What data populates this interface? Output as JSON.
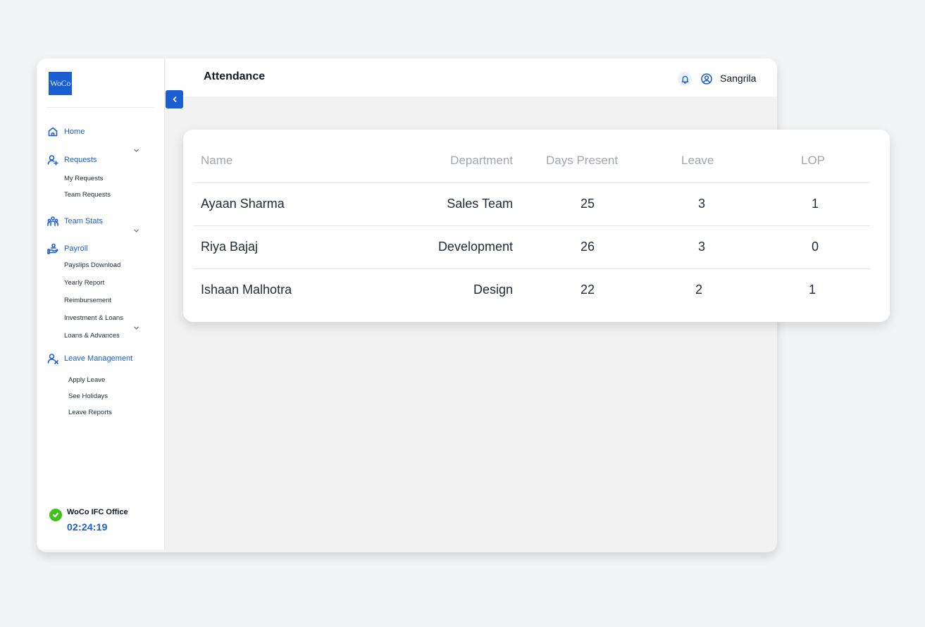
{
  "app": {
    "logo_text": "WoCo",
    "page_title": "Attendance",
    "user_name": "Sangrila"
  },
  "sidebar": {
    "home": "Home",
    "requests": {
      "label": "Requests",
      "items": [
        "My Requests",
        "Team Requests"
      ]
    },
    "team_stats": {
      "label": "Team Stats"
    },
    "payroll": {
      "label": "Payroll",
      "items": [
        "Payslips Download",
        "Yearly Report",
        "Reimbursement",
        "Investment & Loans",
        "Loans & Advances"
      ]
    },
    "leave_management": {
      "label": "Leave Management",
      "items": [
        "Apply Leave",
        "See Holidays",
        "Leave Reports"
      ]
    },
    "office": {
      "name": "WoCo IFC Office",
      "timer": "02:24:19",
      "status_color": "#43c11b"
    }
  },
  "table": {
    "headers": [
      "Name",
      "Department",
      "Days Present",
      "Leave",
      "LOP"
    ],
    "rows": [
      [
        "Ayaan Sharma",
        "Sales Team",
        "25",
        "3",
        "1"
      ],
      [
        "Riya Bajaj",
        "Development",
        "26",
        "3",
        "0"
      ],
      [
        "Ishaan Malhotra",
        "Design",
        "22",
        "2",
        "1"
      ]
    ]
  },
  "icons": {
    "nav": [
      "home-icon",
      "user-plus-icon",
      "team-icon",
      "payroll-hand-icon",
      "user-x-icon"
    ],
    "header": [
      "bell-icon",
      "user-circle-icon"
    ],
    "collapse": "chevron-left-icon"
  },
  "colors": {
    "accent": "#1a5fd1",
    "background": "#f3f4f6",
    "success": "#43c11b"
  }
}
